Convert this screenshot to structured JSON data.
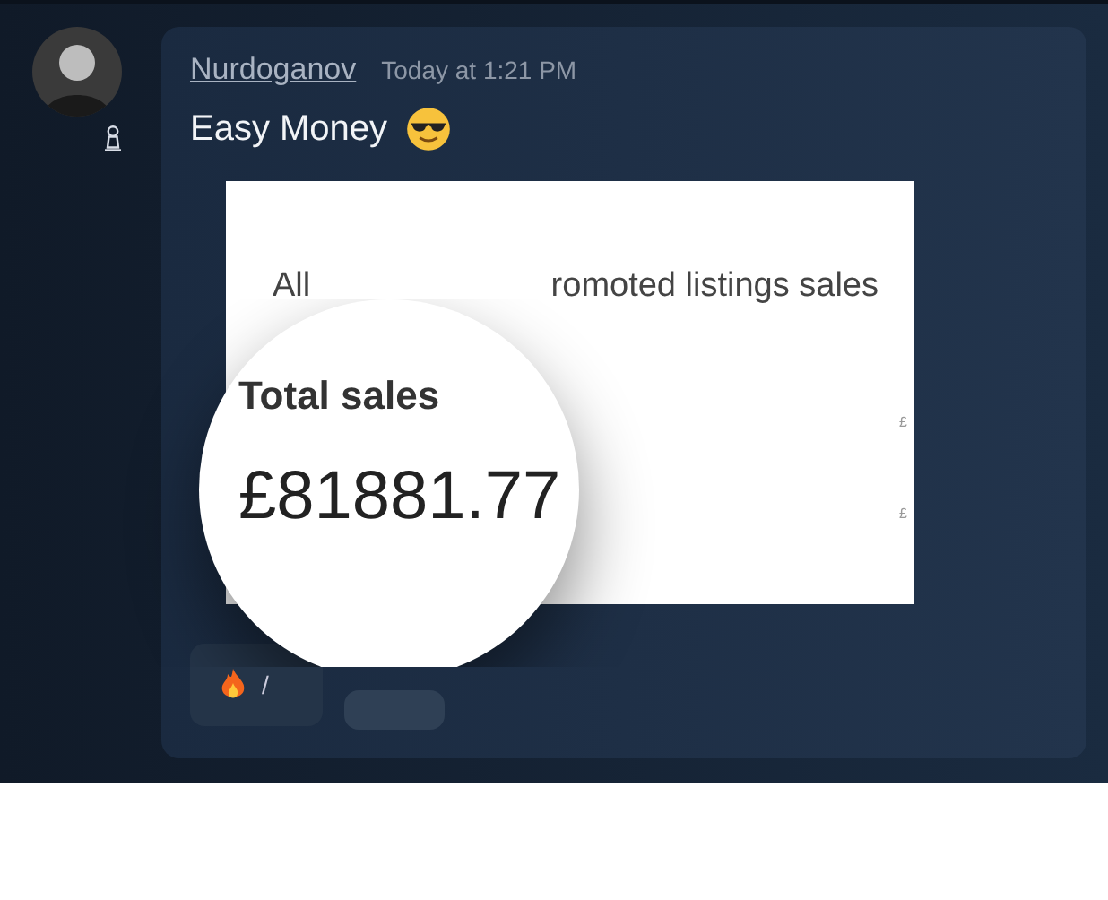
{
  "message": {
    "author": "Nurdoganov",
    "timestamp": "Today at 1:21 PM",
    "text": "Easy Money"
  },
  "embed": {
    "heading_start": "All",
    "heading_end": "romoted listings sales",
    "side_values": [
      "£",
      "£"
    ]
  },
  "magnifier": {
    "label": "Total sales",
    "value": "£81881.77"
  },
  "reactions": [
    {
      "kind": "fire",
      "count": "/"
    },
    {
      "kind": "blank"
    }
  ]
}
